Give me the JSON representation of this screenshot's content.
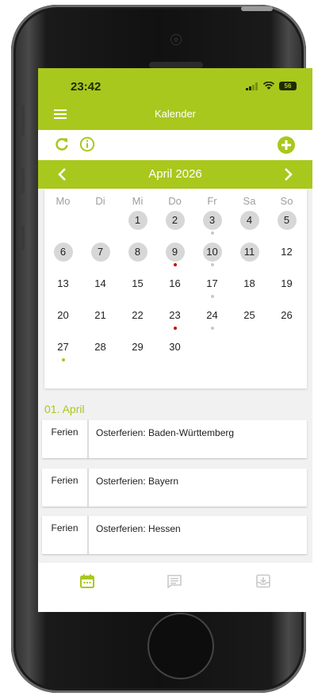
{
  "status": {
    "time": "23:42",
    "battery": "56"
  },
  "appbar": {
    "title": "Kalender"
  },
  "icons": {
    "menu": "menu-icon",
    "refresh": "refresh-icon",
    "info": "info-icon",
    "add": "add-icon",
    "prev": "chevron-left-icon",
    "next": "chevron-right-icon",
    "tab_calendar": "calendar-icon",
    "tab_list": "list-icon",
    "tab_inbox": "inbox-icon"
  },
  "colors": {
    "accent": "#a8c81d",
    "dot_red": "#cc0000",
    "dot_grey": "#c8c8c8"
  },
  "calendar": {
    "month_label": "April 2026",
    "weekdays": [
      "Mo",
      "Di",
      "Mi",
      "Do",
      "Fr",
      "Sa",
      "So"
    ],
    "weeks": [
      [
        "",
        "",
        "1",
        "2",
        "3",
        "4",
        "5"
      ],
      [
        "6",
        "7",
        "8",
        "9",
        "10",
        "11",
        "12"
      ],
      [
        "13",
        "14",
        "15",
        "16",
        "17",
        "18",
        "19"
      ],
      [
        "20",
        "21",
        "22",
        "23",
        "24",
        "25",
        "26"
      ],
      [
        "27",
        "28",
        "29",
        "30",
        "",
        "",
        ""
      ]
    ],
    "highlighted_days": [
      "1",
      "2",
      "3",
      "4",
      "5",
      "6",
      "7",
      "8",
      "9",
      "10",
      "11"
    ],
    "dots": {
      "3": "grey",
      "9": "red",
      "10": "grey",
      "17": "grey",
      "23": "red",
      "24": "grey",
      "27": "green"
    }
  },
  "events_section": {
    "date": "01. April",
    "events": [
      {
        "category": "Ferien",
        "title": "Osterferien: Baden-Württemberg"
      },
      {
        "category": "Ferien",
        "title": "Osterferien: Bayern"
      },
      {
        "category": "Ferien",
        "title": "Osterferien: Hessen"
      }
    ]
  }
}
